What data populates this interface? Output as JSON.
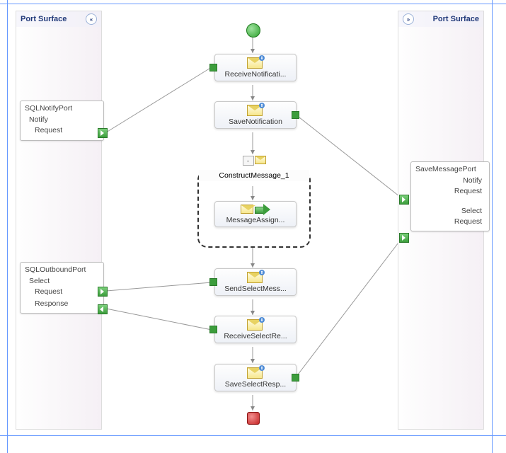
{
  "left_surface": {
    "title": "Port Surface",
    "chevron": "«"
  },
  "right_surface": {
    "title": "Port Surface",
    "chevron": "»"
  },
  "ports": {
    "sqlNotify": {
      "title": "SQLNotifyPort",
      "op": "Notify",
      "request": "Request"
    },
    "sqlOutbound": {
      "title": "SQLOutboundPort",
      "op": "Select",
      "request": "Request",
      "response": "Response"
    },
    "saveMessage": {
      "title": "SaveMessagePort",
      "op1": "Notify",
      "req1": "Request",
      "op2": "Select",
      "req2": "Request"
    }
  },
  "shapes": {
    "receiveNotification": "ReceiveNotificati...",
    "saveNotification": "SaveNotification",
    "constructMessage": "ConstructMessage_1",
    "messageAssign": "MessageAssign...",
    "sendSelect": "SendSelectMess...",
    "receiveSelect": "ReceiveSelectRe...",
    "saveSelect": "SaveSelectResp..."
  }
}
